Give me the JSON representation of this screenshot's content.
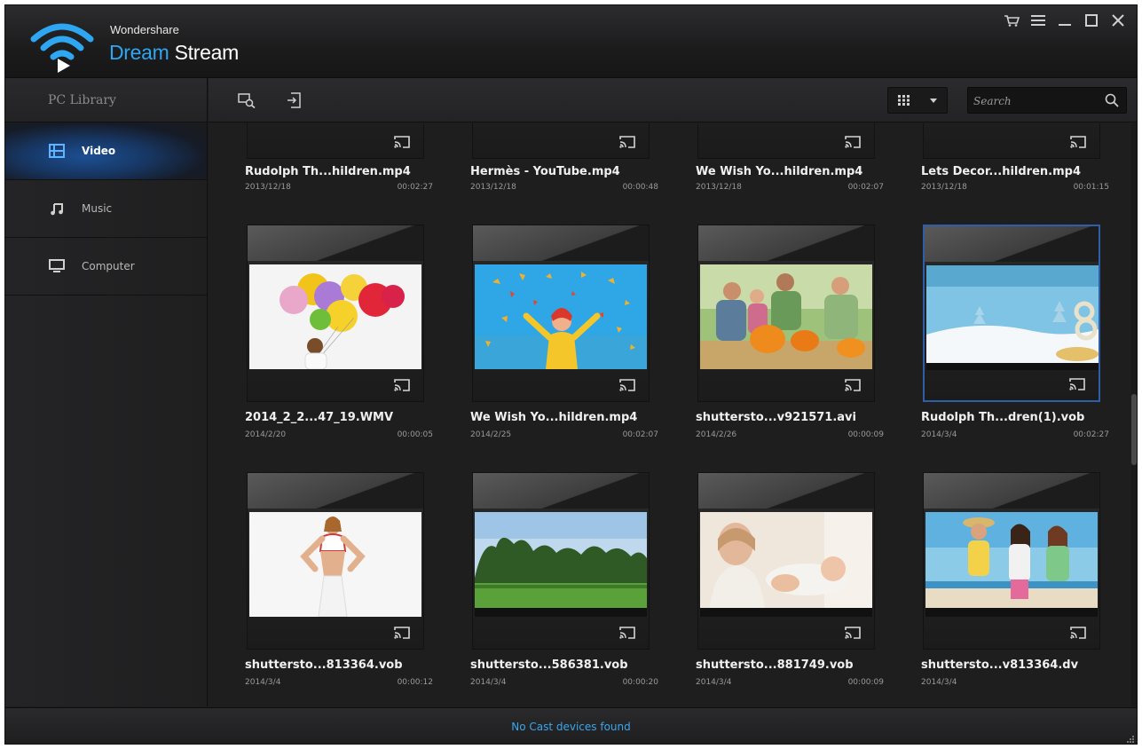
{
  "app": {
    "brand_small": "Wondershare",
    "brand_accent": "Dream",
    "brand_rest": " Stream"
  },
  "colors": {
    "accent": "#2ea6f2",
    "selected_border": "#2f5ea8",
    "status_text": "#3aa6ee"
  },
  "sidebar": {
    "header": "PC Library",
    "items": [
      {
        "label": "Video",
        "icon": "film-icon",
        "active": true
      },
      {
        "label": "Music",
        "icon": "music-note-icon",
        "active": false
      },
      {
        "label": "Computer",
        "icon": "monitor-icon",
        "active": false
      }
    ]
  },
  "toolbar": {
    "search_placeholder": "Search",
    "view_mode": "grid"
  },
  "videos": [
    {
      "name": "Rudolph Th...hildren.mp4",
      "date": "2013/12/18",
      "duration": "00:02:27"
    },
    {
      "name": "Hermès - YouTube.mp4",
      "date": "2013/12/18",
      "duration": "00:00:48"
    },
    {
      "name": "We Wish Yo...hildren.mp4",
      "date": "2013/12/18",
      "duration": "00:02:07"
    },
    {
      "name": "Lets Decor...hildren.mp4",
      "date": "2013/12/18",
      "duration": "00:01:15"
    },
    {
      "name": "2014_2_2...47_19.WMV",
      "date": "2014/2/20",
      "duration": "00:00:05"
    },
    {
      "name": "We Wish Yo...hildren.mp4",
      "date": "2014/2/25",
      "duration": "00:02:07"
    },
    {
      "name": "shuttersto...v921571.avi",
      "date": "2014/2/26",
      "duration": "00:00:09"
    },
    {
      "name": "Rudolph Th...dren(1).vob",
      "date": "2014/3/4",
      "duration": "00:02:27",
      "selected": true
    },
    {
      "name": "shuttersto...813364.vob",
      "date": "2014/3/4",
      "duration": "00:00:12"
    },
    {
      "name": "shuttersto...586381.vob",
      "date": "2014/3/4",
      "duration": "00:00:20"
    },
    {
      "name": "shuttersto...881749.vob",
      "date": "2014/3/4",
      "duration": "00:00:09"
    },
    {
      "name": "shuttersto...v813364.dv",
      "date": "2014/3/4",
      "duration": ""
    }
  ],
  "status": {
    "text": "No Cast devices found"
  }
}
